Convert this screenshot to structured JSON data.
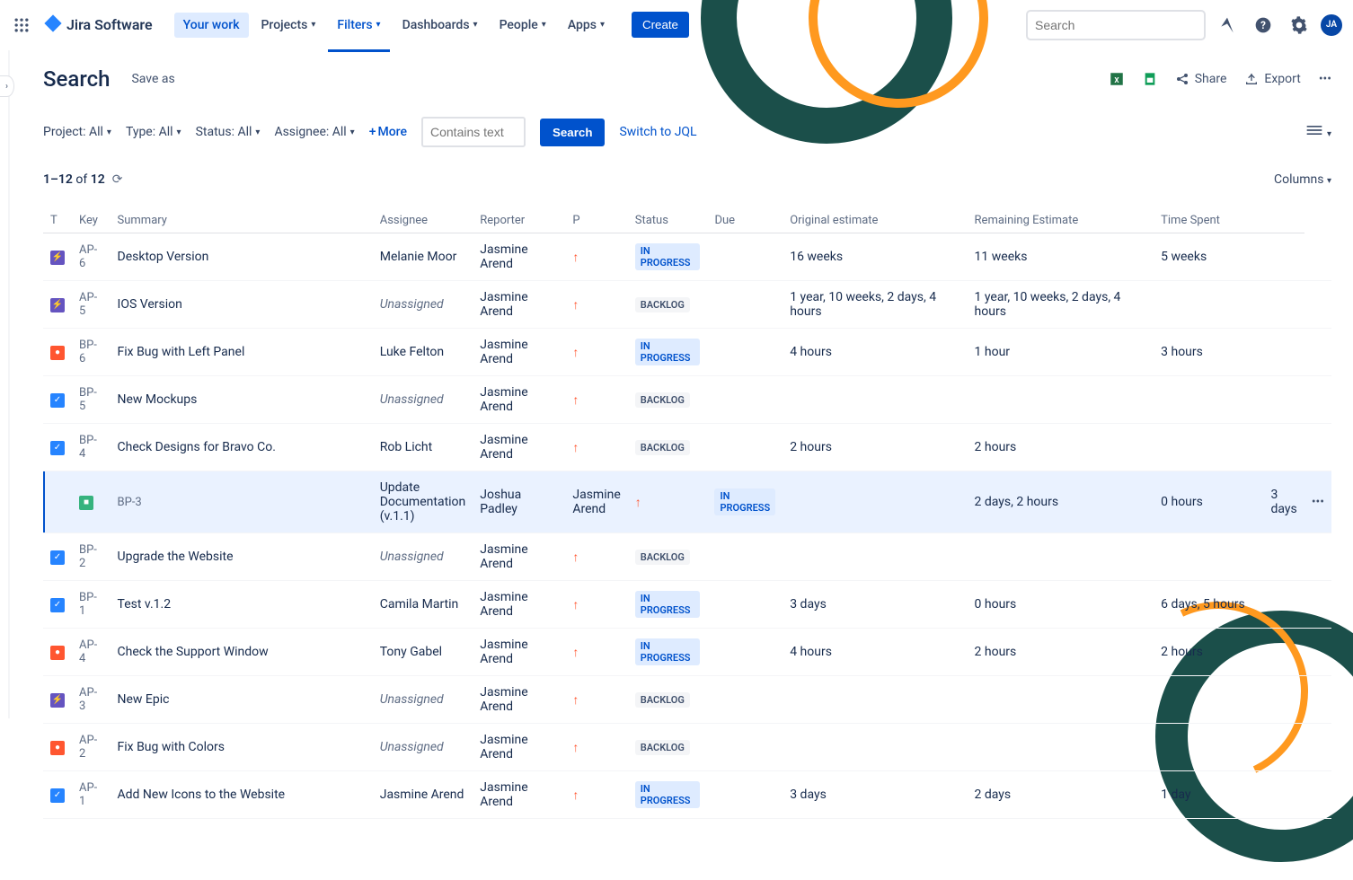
{
  "header": {
    "product": "Jira Software",
    "nav": {
      "your_work": "Your work",
      "projects": "Projects",
      "filters": "Filters",
      "dashboards": "Dashboards",
      "people": "People",
      "apps": "Apps"
    },
    "create": "Create",
    "search_placeholder": "Search",
    "avatar_initials": "JA"
  },
  "page": {
    "title": "Search",
    "save_as": "Save as",
    "share": "Share",
    "export": "Export"
  },
  "filters": {
    "project": "Project: All",
    "type": "Type: All",
    "status": "Status: All",
    "assignee": "Assignee: All",
    "more": "More",
    "contains_placeholder": "Contains text",
    "search_btn": "Search",
    "switch_jql": "Switch to JQL"
  },
  "results": {
    "range": "1–12",
    "of": "of",
    "total": "12",
    "columns": "Columns"
  },
  "columns": {
    "t": "T",
    "key": "Key",
    "summary": "Summary",
    "assignee": "Assignee",
    "reporter": "Reporter",
    "p": "P",
    "status": "Status",
    "due": "Due",
    "original": "Original estimate",
    "remaining": "Remaining Estimate",
    "spent": "Time Spent"
  },
  "rows": [
    {
      "type": "epic",
      "key": "AP-6",
      "summary": "Desktop Version",
      "assignee": "Melanie Moor",
      "reporter": "Jasmine Arend",
      "status": "IN PROGRESS",
      "statusClass": "inprogress",
      "original": "16 weeks",
      "remaining": "11 weeks",
      "spent": "5 weeks"
    },
    {
      "type": "epic",
      "key": "AP-5",
      "summary": "IOS Version",
      "assignee": "Unassigned",
      "reporter": "Jasmine Arend",
      "status": "BACKLOG",
      "statusClass": "backlog",
      "original": "1 year, 10 weeks, 2 days, 4 hours",
      "remaining": "1 year, 10 weeks, 2 days, 4 hours",
      "spent": ""
    },
    {
      "type": "bug",
      "key": "BP-6",
      "summary": "Fix Bug with Left Panel",
      "assignee": "Luke Felton",
      "reporter": "Jasmine Arend",
      "status": "IN PROGRESS",
      "statusClass": "inprogress",
      "original": "4 hours",
      "remaining": "1 hour",
      "spent": "3 hours"
    },
    {
      "type": "task",
      "key": "BP-5",
      "summary": "New Mockups",
      "assignee": "Unassigned",
      "reporter": "Jasmine Arend",
      "status": "BACKLOG",
      "statusClass": "backlog",
      "original": "",
      "remaining": "",
      "spent": ""
    },
    {
      "type": "task",
      "key": "BP-4",
      "summary": "Check Designs for Bravo Co.",
      "assignee": "Rob Licht",
      "reporter": "Jasmine Arend",
      "status": "BACKLOG",
      "statusClass": "backlog",
      "original": "2 hours",
      "remaining": "2 hours",
      "spent": ""
    },
    {
      "type": "story",
      "key": "BP-3",
      "summary": "Update Documentation (v.1.1)",
      "assignee": "Joshua Padley",
      "reporter": "Jasmine Arend",
      "status": "IN PROGRESS",
      "statusClass": "inprogress",
      "original": "2 days, 2 hours",
      "remaining": "0 hours",
      "spent": "3 days",
      "selected": true
    },
    {
      "type": "task",
      "key": "BP-2",
      "summary": "Upgrade the Website",
      "assignee": "Unassigned",
      "reporter": "Jasmine Arend",
      "status": "BACKLOG",
      "statusClass": "backlog",
      "original": "",
      "remaining": "",
      "spent": ""
    },
    {
      "type": "task",
      "key": "BP-1",
      "summary": "Test v.1.2",
      "assignee": "Camila Martin",
      "reporter": "Jasmine Arend",
      "status": "IN PROGRESS",
      "statusClass": "inprogress",
      "original": "3 days",
      "remaining": "0 hours",
      "spent": "6 days, 5 hours"
    },
    {
      "type": "bug",
      "key": "AP-4",
      "summary": "Check the Support Window",
      "assignee": "Tony Gabel",
      "reporter": "Jasmine Arend",
      "status": "IN PROGRESS",
      "statusClass": "inprogress",
      "original": "4 hours",
      "remaining": "2 hours",
      "spent": "2 hours"
    },
    {
      "type": "epic",
      "key": "AP-3",
      "summary": "New Epic",
      "assignee": "Unassigned",
      "reporter": "Jasmine Arend",
      "status": "BACKLOG",
      "statusClass": "backlog",
      "original": "",
      "remaining": "",
      "spent": ""
    },
    {
      "type": "bug",
      "key": "AP-2",
      "summary": "Fix Bug with Colors",
      "assignee": "Unassigned",
      "reporter": "Jasmine Arend",
      "status": "BACKLOG",
      "statusClass": "backlog",
      "original": "",
      "remaining": "",
      "spent": ""
    },
    {
      "type": "task",
      "key": "AP-1",
      "summary": "Add New Icons to the Website",
      "assignee": "Jasmine Arend",
      "reporter": "Jasmine Arend",
      "status": "IN PROGRESS",
      "statusClass": "inprogress",
      "original": "3 days",
      "remaining": "2 days",
      "spent": "1 day"
    }
  ]
}
